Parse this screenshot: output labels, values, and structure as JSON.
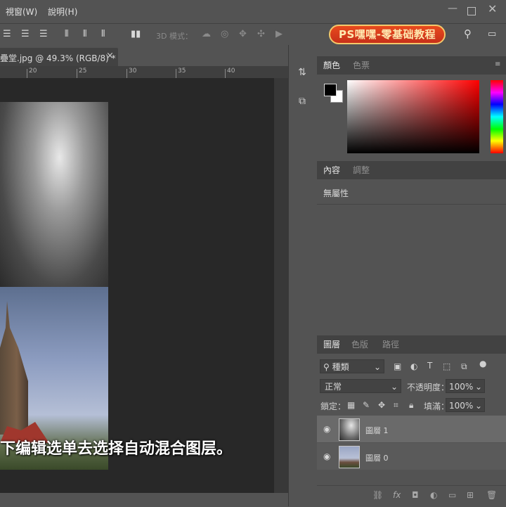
{
  "menu": {
    "view": "視窗(W)",
    "help": "說明(H)"
  },
  "options": {
    "mode_3d_label": "3D 模式："
  },
  "brand": {
    "text": "PS嘿嘿-零基础教程"
  },
  "document": {
    "tab_title": "疊堂.jpg @ 49.3% (RGB/8) *",
    "close": "×"
  },
  "ruler": {
    "labels": [
      "20",
      "25",
      "30",
      "35",
      "40"
    ]
  },
  "subtitle": {
    "text": "下编辑选单去选择自动混合图层。"
  },
  "color_panel": {
    "tabs": [
      "顏色",
      "色票"
    ],
    "foreground": "#000000",
    "background": "#ffffff"
  },
  "properties_panel": {
    "tabs": [
      "內容",
      "調整"
    ],
    "no_attributes": "無屬性"
  },
  "layers_panel": {
    "tabs": [
      "圖層",
      "色版",
      "路徑"
    ],
    "filter_kind": "種類",
    "blend_mode": "正常",
    "opacity_label": "不透明度：",
    "opacity_value": "100%",
    "lock_label": "鎖定：",
    "fill_label": "填滿：",
    "fill_value": "100%",
    "layers": [
      {
        "name": "圖層 1"
      },
      {
        "name": "圖層 0"
      }
    ]
  }
}
